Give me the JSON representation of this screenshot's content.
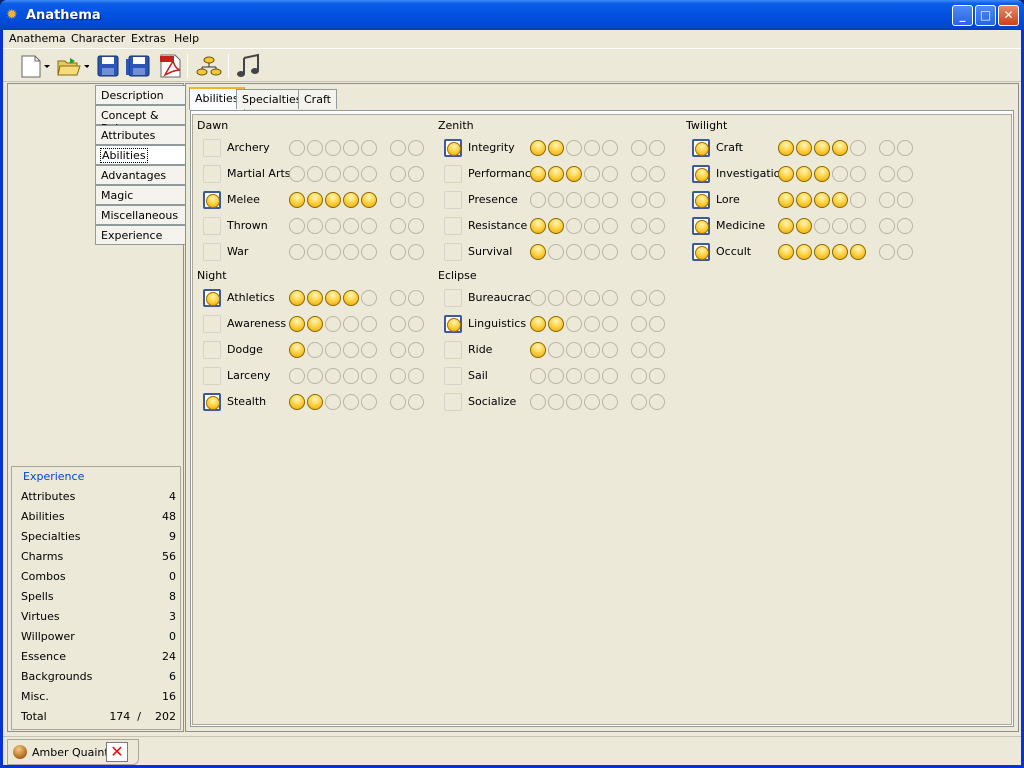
{
  "window": {
    "title": "Anathema",
    "minimize": "_",
    "maximize": "□",
    "close": "✕"
  },
  "menu": [
    "Anathema",
    "Character",
    "Extras",
    "Help"
  ],
  "toolbar": [
    "new-doc-icon",
    "open-folder-icon",
    "save-icon",
    "save-all-icon",
    "pdf-icon",
    "hierarchy-icon",
    "music-icon"
  ],
  "nav": [
    "Description",
    "Concept & Rules",
    "Attributes",
    "Abilities",
    "Advantages",
    "Magic",
    "Miscellaneous",
    "Experience"
  ],
  "nav_selected": "Abilities",
  "experience": {
    "title": "Experience",
    "rows": [
      {
        "label": "Attributes",
        "value": "4"
      },
      {
        "label": "Abilities",
        "value": "48"
      },
      {
        "label": "Specialties",
        "value": "9"
      },
      {
        "label": "Charms",
        "value": "56"
      },
      {
        "label": "Combos",
        "value": "0"
      },
      {
        "label": "Spells",
        "value": "8"
      },
      {
        "label": "Virtues",
        "value": "3"
      },
      {
        "label": "Willpower",
        "value": "0"
      },
      {
        "label": "Essence",
        "value": "24"
      },
      {
        "label": "Backgrounds",
        "value": "6"
      },
      {
        "label": "Misc.",
        "value": "16"
      },
      {
        "label": "Total",
        "value": "174  /    202"
      }
    ]
  },
  "tabs": [
    "Abilities",
    "Specialties",
    "Craft"
  ],
  "groups": [
    {
      "name": "Dawn",
      "abilities": [
        {
          "label": "Archery",
          "favored": false,
          "dots": 0
        },
        {
          "label": "Martial Arts",
          "favored": false,
          "dots": 0
        },
        {
          "label": "Melee",
          "favored": true,
          "dots": 5
        },
        {
          "label": "Thrown",
          "favored": false,
          "dots": 0
        },
        {
          "label": "War",
          "favored": false,
          "dots": 0
        }
      ]
    },
    {
      "name": "Night",
      "abilities": [
        {
          "label": "Athletics",
          "favored": true,
          "dots": 4
        },
        {
          "label": "Awareness",
          "favored": false,
          "dots": 2
        },
        {
          "label": "Dodge",
          "favored": false,
          "dots": 1
        },
        {
          "label": "Larceny",
          "favored": false,
          "dots": 0
        },
        {
          "label": "Stealth",
          "favored": true,
          "dots": 2
        }
      ]
    },
    {
      "name": "Zenith",
      "abilities": [
        {
          "label": "Integrity",
          "favored": true,
          "dots": 2
        },
        {
          "label": "Performance",
          "favored": false,
          "dots": 3
        },
        {
          "label": "Presence",
          "favored": false,
          "dots": 0
        },
        {
          "label": "Resistance",
          "favored": false,
          "dots": 2
        },
        {
          "label": "Survival",
          "favored": false,
          "dots": 1
        }
      ]
    },
    {
      "name": "Eclipse",
      "abilities": [
        {
          "label": "Bureaucracy",
          "favored": false,
          "dots": 0
        },
        {
          "label": "Linguistics",
          "favored": true,
          "dots": 2
        },
        {
          "label": "Ride",
          "favored": false,
          "dots": 1
        },
        {
          "label": "Sail",
          "favored": false,
          "dots": 0
        },
        {
          "label": "Socialize",
          "favored": false,
          "dots": 0
        }
      ]
    },
    {
      "name": "Twilight",
      "abilities": [
        {
          "label": "Craft",
          "favored": true,
          "dots": 4
        },
        {
          "label": "Investigation",
          "favored": true,
          "dots": 3
        },
        {
          "label": "Lore",
          "favored": true,
          "dots": 4
        },
        {
          "label": "Medicine",
          "favored": true,
          "dots": 2
        },
        {
          "label": "Occult",
          "favored": true,
          "dots": 5
        }
      ]
    }
  ],
  "character_tab": {
    "name": "Amber Quaint",
    "close": "✕"
  }
}
